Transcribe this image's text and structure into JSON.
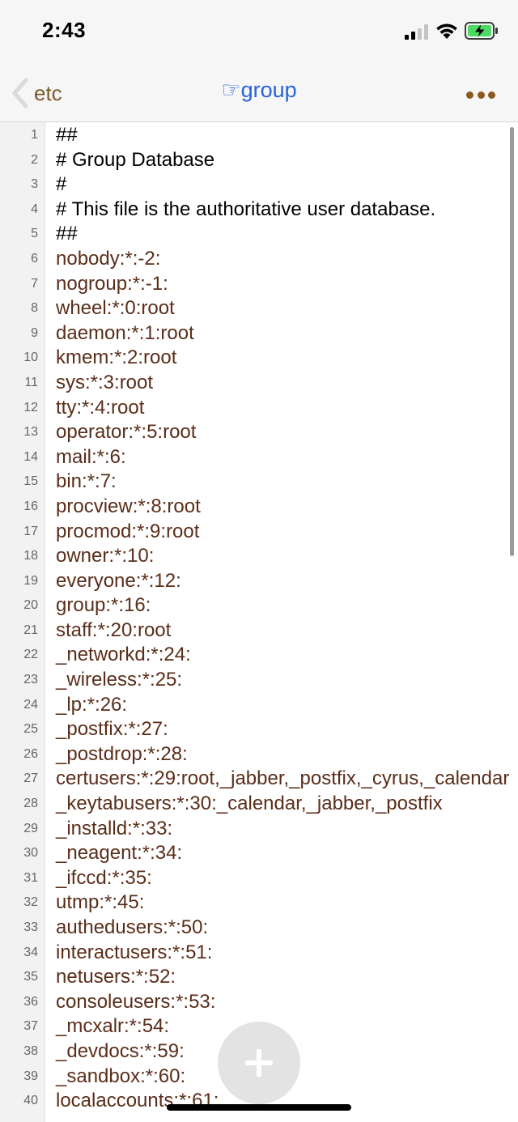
{
  "status_bar": {
    "time": "2:43"
  },
  "nav": {
    "back_label": "etc",
    "title": "☞group"
  },
  "colors": {
    "accent_blue": "#2a62d8",
    "brown_text": "#5a2e1a",
    "back_brown": "#7a5a2a",
    "battery_green": "#4cd964"
  },
  "editor": {
    "lines": [
      {
        "num": "1",
        "text": "##"
      },
      {
        "num": "2",
        "text": "# Group Database"
      },
      {
        "num": "3",
        "text": "#"
      },
      {
        "num": "4",
        "text": "# This file is the authoritative user database."
      },
      {
        "num": "5",
        "text": "##"
      },
      {
        "num": "6",
        "text": "nobody:*:-2:"
      },
      {
        "num": "7",
        "text": "nogroup:*:-1:"
      },
      {
        "num": "8",
        "text": "wheel:*:0:root"
      },
      {
        "num": "9",
        "text": "daemon:*:1:root"
      },
      {
        "num": "10",
        "text": "kmem:*:2:root"
      },
      {
        "num": "11",
        "text": "sys:*:3:root"
      },
      {
        "num": "12",
        "text": "tty:*:4:root"
      },
      {
        "num": "13",
        "text": "operator:*:5:root"
      },
      {
        "num": "14",
        "text": "mail:*:6:"
      },
      {
        "num": "15",
        "text": "bin:*:7:"
      },
      {
        "num": "16",
        "text": "procview:*:8:root"
      },
      {
        "num": "17",
        "text": "procmod:*:9:root"
      },
      {
        "num": "18",
        "text": "owner:*:10:"
      },
      {
        "num": "19",
        "text": "everyone:*:12:"
      },
      {
        "num": "20",
        "text": "group:*:16:"
      },
      {
        "num": "21",
        "text": "staff:*:20:root"
      },
      {
        "num": "22",
        "text": "_networkd:*:24:"
      },
      {
        "num": "23",
        "text": "_wireless:*:25:"
      },
      {
        "num": "24",
        "text": "_lp:*:26:"
      },
      {
        "num": "25",
        "text": "_postfix:*:27:"
      },
      {
        "num": "26",
        "text": "_postdrop:*:28:"
      },
      {
        "num": "27",
        "text": "certusers:*:29:root,_jabber,_postfix,_cyrus,_calendar"
      },
      {
        "num": "28",
        "text": "_keytabusers:*:30:_calendar,_jabber,_postfix"
      },
      {
        "num": "29",
        "text": "_installd:*:33:"
      },
      {
        "num": "30",
        "text": "_neagent:*:34:"
      },
      {
        "num": "31",
        "text": "_ifccd:*:35:"
      },
      {
        "num": "32",
        "text": "utmp:*:45:"
      },
      {
        "num": "33",
        "text": "authedusers:*:50:"
      },
      {
        "num": "34",
        "text": "interactusers:*:51:"
      },
      {
        "num": "35",
        "text": "netusers:*:52:"
      },
      {
        "num": "36",
        "text": "consoleusers:*:53:"
      },
      {
        "num": "37",
        "text": "_mcxalr:*:54:"
      },
      {
        "num": "38",
        "text": "_devdocs:*:59:"
      },
      {
        "num": "39",
        "text": "_sandbox:*:60:"
      },
      {
        "num": "40",
        "text": "localaccounts:*:61:"
      }
    ]
  },
  "icons": {
    "back": "chevron-left-icon",
    "more": "ellipsis-icon",
    "add": "plus-icon",
    "signal": "cellular-signal-icon",
    "wifi": "wifi-icon",
    "battery": "battery-charging-icon"
  }
}
